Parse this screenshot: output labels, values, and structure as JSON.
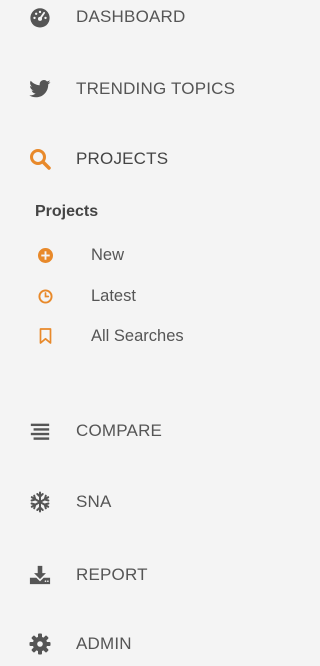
{
  "colors": {
    "accent": "#e8892a",
    "icon_dark": "#555555",
    "text": "#555555",
    "background": "#f4f4f4"
  },
  "nav": {
    "dashboard": {
      "label": "DASHBOARD",
      "icon": "dashboard-gauge-icon"
    },
    "trending": {
      "label": "TRENDING TOPICS",
      "icon": "twitter-bird-icon"
    },
    "projects": {
      "label": "PROJECTS",
      "icon": "search-icon"
    },
    "compare": {
      "label": "COMPARE",
      "icon": "align-lines-icon"
    },
    "sna": {
      "label": "SNA",
      "icon": "snowflake-icon"
    },
    "report": {
      "label": "REPORT",
      "icon": "download-icon"
    },
    "admin": {
      "label": "ADMIN",
      "icon": "gear-icon"
    }
  },
  "projects_section": {
    "heading": "Projects",
    "items": [
      {
        "label": "New",
        "icon": "plus-circle-icon"
      },
      {
        "label": "Latest",
        "icon": "clock-icon"
      },
      {
        "label": "All Searches",
        "icon": "bookmark-icon"
      }
    ]
  }
}
